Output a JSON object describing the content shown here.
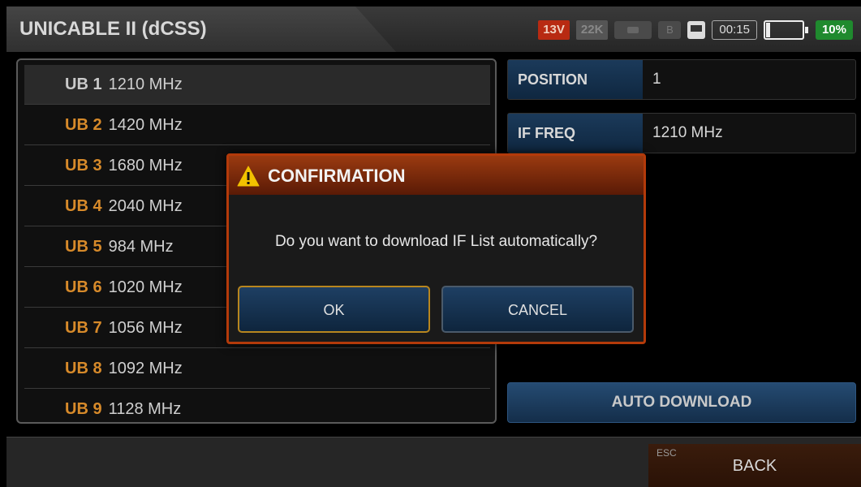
{
  "header": {
    "title": "UNICABLE II (dCSS)",
    "voltage": "13V",
    "tone": "22K",
    "b_indicator": "B",
    "time": "00:15",
    "battery_percent": "10%"
  },
  "colors": {
    "accent_orange": "#d78a2a",
    "dialog_border": "#b33a0a",
    "button_blue": "#1e3f63",
    "battery_green": "#1f8a2e",
    "voltage_red": "#b82a12"
  },
  "ub_list": [
    {
      "num": "UB 1",
      "freq": "1210 MHz",
      "selected": true
    },
    {
      "num": "UB 2",
      "freq": "1420 MHz",
      "selected": false
    },
    {
      "num": "UB 3",
      "freq": "1680 MHz",
      "selected": false
    },
    {
      "num": "UB 4",
      "freq": "2040 MHz",
      "selected": false
    },
    {
      "num": "UB 5",
      "freq": "984 MHz",
      "selected": false
    },
    {
      "num": "UB 6",
      "freq": "1020 MHz",
      "selected": false
    },
    {
      "num": "UB 7",
      "freq": "1056 MHz",
      "selected": false
    },
    {
      "num": "UB 8",
      "freq": "1092 MHz",
      "selected": false
    },
    {
      "num": "UB 9",
      "freq": "1128 MHz",
      "selected": false
    }
  ],
  "info": {
    "position_label": "POSITION",
    "position_value": "1",
    "if_freq_label": "IF FREQ",
    "if_freq_value": "1210 MHz"
  },
  "auto_download_label": "AUTO DOWNLOAD",
  "footer": {
    "esc_label": "ESC",
    "back_label": "BACK"
  },
  "dialog": {
    "icon": "warning-icon",
    "title": "CONFIRMATION",
    "message": "Do you want to download IF List automatically?",
    "ok_label": "OK",
    "cancel_label": "CANCEL"
  }
}
